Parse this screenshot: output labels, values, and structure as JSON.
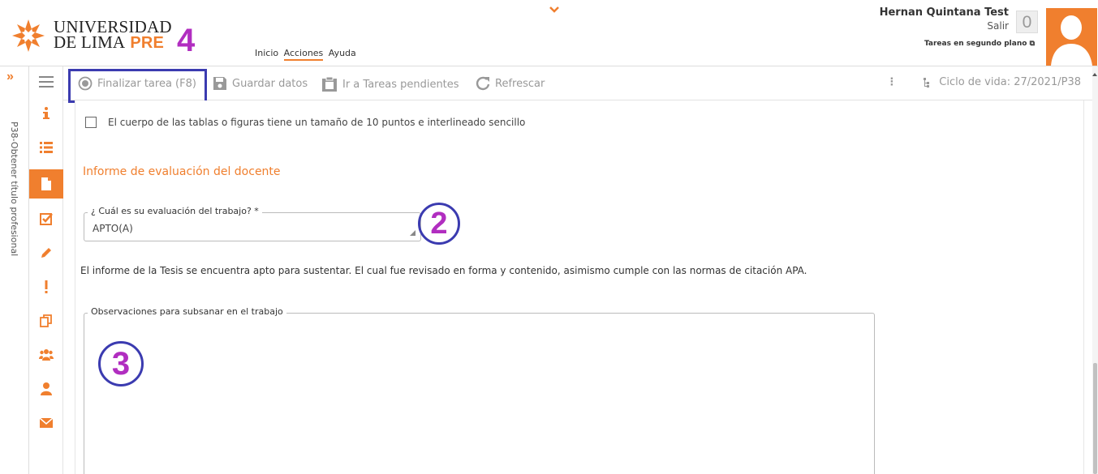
{
  "header": {
    "logo_line1": "UNIVERSIDAD",
    "logo_line2": "DE LIMA",
    "logo_pre": "PRE",
    "annotation_4": "4",
    "nav": [
      "Inicio",
      "Acciones",
      "Ayuda"
    ],
    "user_name": "Hernan Quintana Test",
    "logout": "Salir",
    "counter": "0",
    "background_tasks": "Tareas en segundo plano"
  },
  "side_panel": {
    "vertical_label": "P38-Obtener título profesional"
  },
  "sidebar": {
    "icons": [
      "info-icon",
      "list-icon",
      "document-icon",
      "checkbox-icon",
      "pencil-icon",
      "exclamation-icon",
      "copy-icon",
      "group-icon",
      "user-icon",
      "envelope-icon"
    ],
    "active_index": 2
  },
  "toolbar": {
    "finalize": "Finalizar tarea (F8)",
    "save": "Guardar datos",
    "pending": "Ir a Tareas pendientes",
    "refresh": "Refrescar",
    "lifecycle": "Ciclo de vida: 27/2021/P38"
  },
  "form": {
    "checkbox_label": "El cuerpo de las tablas o figuras tiene un tamaño de 10 puntos e interlineado sencillo",
    "section_title": "Informe de evaluación del docente",
    "evaluation_label": "¿ Cuál es su evaluación del trabajo? *",
    "evaluation_value": "APTO(A)",
    "info_text": "El informe de la Tesis se encuentra apto para sustentar. El cual fue revisado en forma y contenido, asimismo cumple con las normas de citación APA.",
    "observations_label": "Observaciones para subsanar en el trabajo",
    "observations_value": ""
  },
  "annotations": {
    "two": "2",
    "three": "3"
  },
  "colors": {
    "accent": "#f07f2e",
    "annotation_border": "#3b3bb0",
    "annotation_text": "#b12ec0"
  }
}
